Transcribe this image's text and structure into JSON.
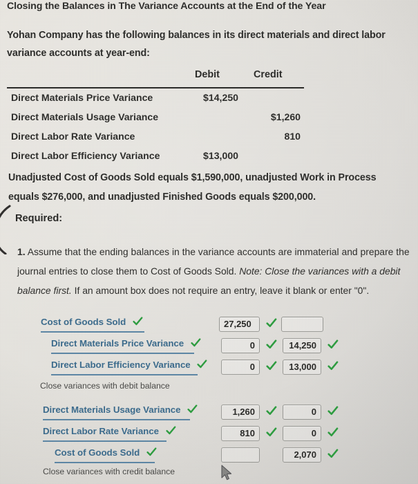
{
  "title": "Closing the Balances in The Variance Accounts at the End of the Year",
  "intro": "Yohan Company has the following balances in its direct materials and direct labor variance accounts at year-end:",
  "balances_table": {
    "columns": [
      "",
      "Debit",
      "Credit"
    ],
    "rows": [
      {
        "account": "Direct Materials Price Variance",
        "debit": "$14,250",
        "credit": ""
      },
      {
        "account": "Direct Materials Usage Variance",
        "debit": "",
        "credit": "$1,260"
      },
      {
        "account": "Direct Labor Rate Variance",
        "debit": "",
        "credit": "810"
      },
      {
        "account": "Direct Labor Efficiency Variance",
        "debit": "$13,000",
        "credit": ""
      }
    ]
  },
  "unadjusted": "Unadjusted Cost of Goods Sold equals $1,590,000, unadjusted Work in Process equals $276,000, and unadjusted Finished Goods equals $200,000.",
  "required_label": "Required:",
  "requirement_1": {
    "number": "1.",
    "part_a": "Assume that the ending balances in the variance accounts are immaterial and prepare the journal entries to close them to Cost of Goods Sold. ",
    "note_italic": "Note: Close the variances with a debit balance first.",
    "part_b": " If an amount box does not require an entry, leave it blank or enter \"0\"."
  },
  "journal": {
    "entry_1": {
      "rows": [
        {
          "account": "Cost of Goods Sold",
          "account_checked": true,
          "debit": "27,250",
          "debit_align": "left",
          "debit_checked": true,
          "credit": "",
          "credit_checked": false
        },
        {
          "account": "Direct Materials Price Variance",
          "account_checked": true,
          "debit": "0",
          "debit_align": "right",
          "debit_checked": true,
          "credit": "14,250",
          "credit_checked": true
        },
        {
          "account": "Direct Labor Efficiency Variance",
          "account_checked": true,
          "debit": "0",
          "debit_align": "right",
          "debit_checked": true,
          "credit": "13,000",
          "credit_checked": true
        }
      ],
      "caption": "Close variances with debit balance"
    },
    "entry_2": {
      "rows": [
        {
          "account": "Direct Materials Usage Variance",
          "account_checked": true,
          "debit": "1,260",
          "debit_align": "right",
          "debit_checked": true,
          "credit": "0",
          "credit_checked": true
        },
        {
          "account": "Direct Labor Rate Variance",
          "account_checked": true,
          "debit": "810",
          "debit_align": "right",
          "debit_checked": true,
          "credit": "0",
          "credit_checked": true
        },
        {
          "account": "Cost of Goods Sold",
          "account_checked": true,
          "debit": "",
          "debit_align": "right",
          "debit_checked": false,
          "credit": "2,070",
          "credit_checked": true
        }
      ],
      "caption": "Close variances with credit balance"
    }
  },
  "colors": {
    "page_background": "#e9e7e2",
    "body_text": "#2f2f2d",
    "account_link": "#3c6b8c",
    "account_underline": "#5d86a4",
    "check_green": "#2e9c40",
    "box_border": "#9a9a96",
    "rule": "#2b2b29"
  },
  "icons": {
    "check": "check-icon",
    "cursor": "mouse-cursor-icon",
    "ink_arc": "ink-annotation-arc"
  }
}
